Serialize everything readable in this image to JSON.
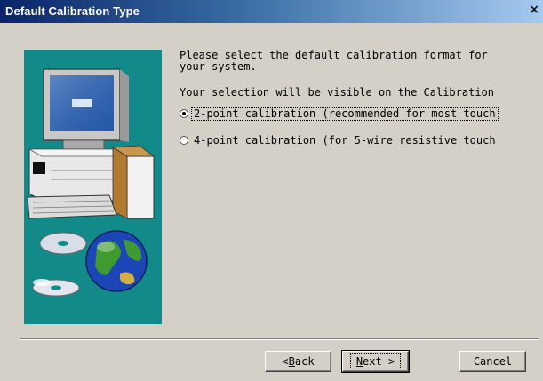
{
  "window": {
    "title": "Default Calibration Type",
    "close_glyph": "×"
  },
  "content": {
    "prompt": "Please select the default calibration format for\nyour system.",
    "subprompt": "Your selection will be visible on the Calibration",
    "options": [
      {
        "label": "2-point calibration (recommended for most touch",
        "selected": true
      },
      {
        "label": "4-point calibration (for 5-wire resistive touch",
        "selected": false
      }
    ]
  },
  "buttons": {
    "back_prefix": "< ",
    "back_key": "B",
    "back_rest": "ack",
    "next_key": "N",
    "next_rest": "ext >",
    "cancel": "Cancel"
  },
  "icons": {
    "artwork": "computer-and-globe-illustration",
    "close": "close-icon"
  },
  "colors": {
    "title_bar_start": "#0a246a",
    "title_bar_end": "#a6caf0",
    "art_background": "#138a8a",
    "dialog_face": "#d4d0c8"
  }
}
